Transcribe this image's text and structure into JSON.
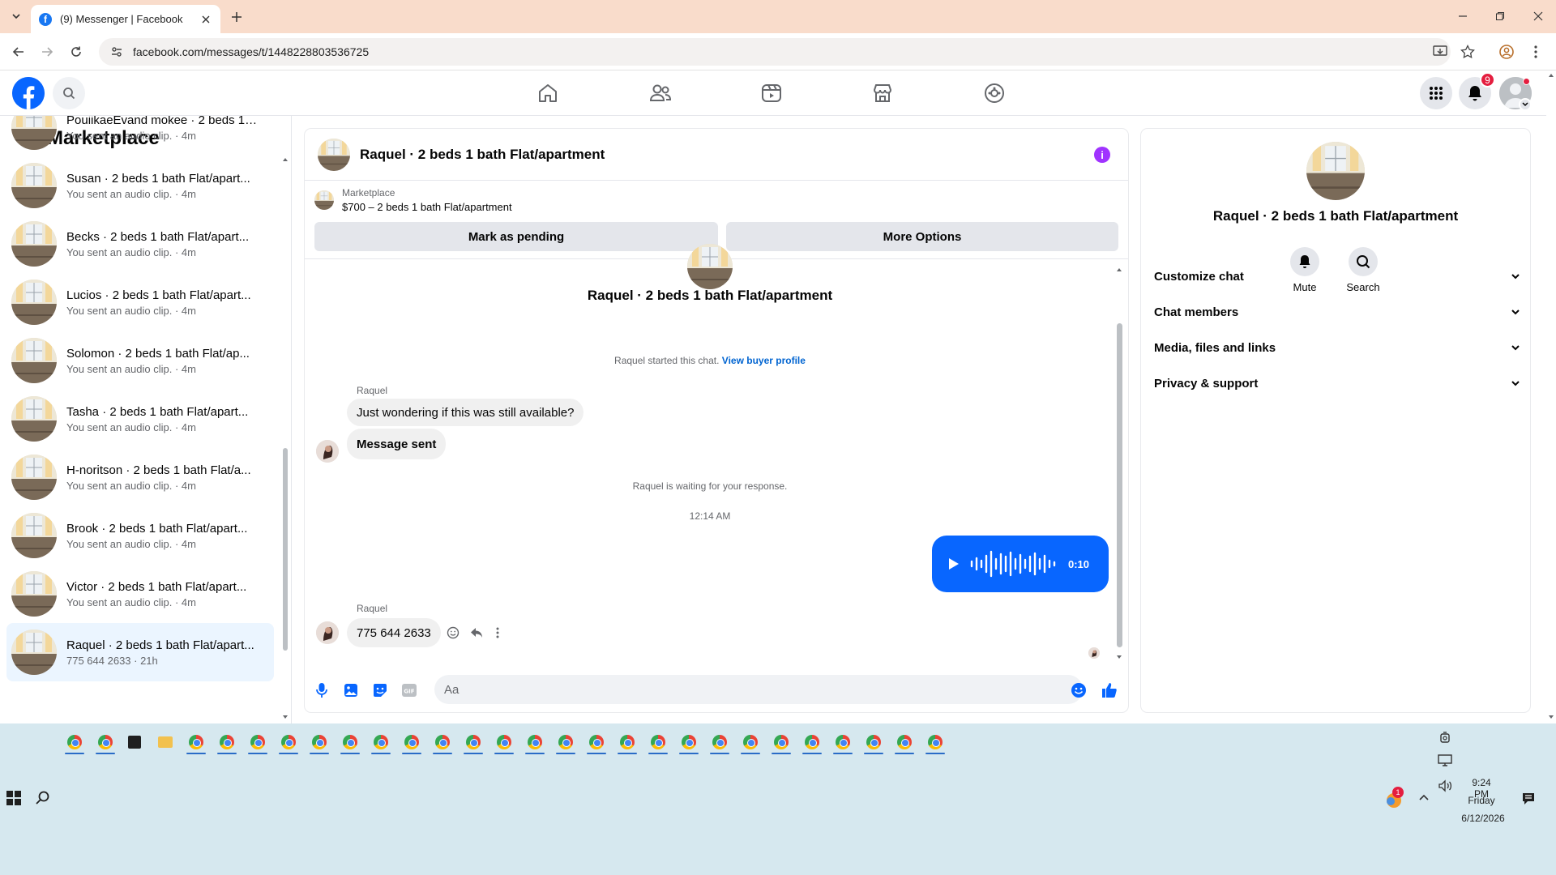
{
  "browser": {
    "tab_title": "(9) Messenger | Facebook",
    "url": "facebook.com/messages/t/1448228803536725"
  },
  "header": {
    "notification_count": "9"
  },
  "sidebar": {
    "title": "Marketplace",
    "conversations": [
      {
        "name": "PouiikaeEvand mokee · 2 beds 1 b...",
        "sub": "You sent an audio clip. · 4m"
      },
      {
        "name": "Susan · 2 beds 1 bath Flat/apart...",
        "sub": "You sent an audio clip. · 4m"
      },
      {
        "name": "Becks · 2 beds 1 bath Flat/apart...",
        "sub": "You sent an audio clip. · 4m"
      },
      {
        "name": "Lucios · 2 beds 1 bath Flat/apart...",
        "sub": "You sent an audio clip. · 4m"
      },
      {
        "name": "Solomon · 2 beds 1 bath Flat/ap...",
        "sub": "You sent an audio clip. · 4m"
      },
      {
        "name": "Tasha · 2 beds 1 bath Flat/apart...",
        "sub": "You sent an audio clip. · 4m"
      },
      {
        "name": "H-noritson · 2 beds 1 bath Flat/a...",
        "sub": "You sent an audio clip. · 4m"
      },
      {
        "name": "Brook · 2 beds 1 bath Flat/apart...",
        "sub": "You sent an audio clip. · 4m"
      },
      {
        "name": "Victor · 2 beds 1 bath Flat/apart...",
        "sub": "You sent an audio clip. · 4m"
      },
      {
        "name": "Raquel · 2 beds 1 bath Flat/apart...",
        "sub": "775 644 2633 · 21h"
      }
    ]
  },
  "chat": {
    "title": "Raquel · 2 beds 1 bath Flat/apartment",
    "listing_label": "Marketplace",
    "listing_price": "$700 – 2 beds 1 bath Flat/apartment",
    "mark_pending": "Mark as pending",
    "more_options": "More Options",
    "intro_title": "Raquel · 2 beds 1 bath Flat/apartment",
    "started_text": "Raquel started this chat.",
    "view_profile": "View buyer profile",
    "sender1": "Raquel",
    "msg1": "Just wondering if this was still available?",
    "msg2": "Message sent",
    "waiting": "Raquel is waiting for your response.",
    "timestamp": "12:14 AM",
    "audio_duration": "0:10",
    "sender2": "Raquel",
    "msg3": "775 644 2633",
    "composer_placeholder": "Aa"
  },
  "details": {
    "name": "Raquel · 2 beds 1 bath Flat/apartment",
    "mute": "Mute",
    "search": "Search",
    "rows": [
      "Customize chat",
      "Chat members",
      "Media, files and links",
      "Privacy & support"
    ]
  },
  "taskbar": {
    "time": "9:24 PM",
    "day": "Friday",
    "date": "6/12/2026",
    "tray_badge": "1"
  },
  "colors": {
    "fb_blue": "#0866ff",
    "badge_red": "#e41e3f",
    "info_purple": "#a033ff",
    "chrome_tab_bar": "#f9dccb",
    "taskbar": "#d6e8ef"
  }
}
